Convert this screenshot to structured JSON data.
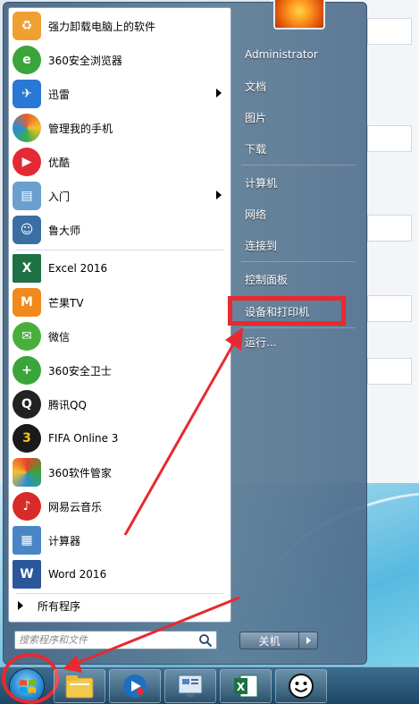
{
  "start_menu": {
    "pinned_programs": [
      {
        "label": "强力卸载电脑上的软件",
        "icon": "uninstall-icon",
        "color": "#f0a030"
      },
      {
        "label": "360安全浏览器",
        "icon": "browser-360-icon",
        "color": "#3aa53a"
      },
      {
        "label": "迅雷",
        "icon": "xunlei-icon",
        "color": "#2a78d6",
        "submenu": true
      },
      {
        "label": "管理我的手机",
        "icon": "phone-manager-icon",
        "color": "#e5612b"
      },
      {
        "label": "优酷",
        "icon": "youku-icon",
        "color": "#e32a35"
      },
      {
        "label": "入门",
        "icon": "getting-started-icon",
        "color": "#6b9fd0",
        "submenu": true
      },
      {
        "label": "鲁大师",
        "icon": "ludashi-icon",
        "color": "#3b6fa3"
      }
    ],
    "recent_programs": [
      {
        "label": "Excel 2016",
        "icon": "excel-icon",
        "color": "#1e7145"
      },
      {
        "label": "芒果TV",
        "icon": "mangotv-icon",
        "color": "#f08a1c"
      },
      {
        "label": "微信",
        "icon": "wechat-icon",
        "color": "#48b03a"
      },
      {
        "label": "360安全卫士",
        "icon": "safeguard-360-icon",
        "color": "#3aa53a"
      },
      {
        "label": "腾讯QQ",
        "icon": "qq-icon",
        "color": "#222222"
      },
      {
        "label": "FIFA Online 3",
        "icon": "fifa-icon",
        "color": "#1a1a1a"
      },
      {
        "label": "360软件管家",
        "icon": "software-manager-360-icon",
        "color": "#e8402a"
      },
      {
        "label": "网易云音乐",
        "icon": "netease-music-icon",
        "color": "#d92a2a"
      },
      {
        "label": "计算器",
        "icon": "calculator-icon",
        "color": "#4a86c5"
      },
      {
        "label": "Word 2016",
        "icon": "word-icon",
        "color": "#2b579a"
      }
    ],
    "all_programs_label": "所有程序",
    "search_placeholder": "搜索程序和文件",
    "right_items": [
      {
        "label": "Administrator"
      },
      {
        "label": "文档"
      },
      {
        "label": "图片"
      },
      {
        "label": "下载"
      },
      {
        "label": "计算机"
      },
      {
        "label": "网络"
      },
      {
        "label": "连接到"
      },
      {
        "label": "控制面板"
      },
      {
        "label": "设备和打印机"
      },
      {
        "label": "运行..."
      }
    ],
    "shutdown_label": "关机"
  },
  "taskbar": {
    "items": [
      {
        "icon": "file-explorer-icon"
      },
      {
        "icon": "media-player-icon"
      },
      {
        "icon": "control-panel-icon"
      },
      {
        "icon": "excel-icon"
      },
      {
        "icon": "smiley-app-icon"
      }
    ]
  },
  "annotation_color": "#e8292f"
}
